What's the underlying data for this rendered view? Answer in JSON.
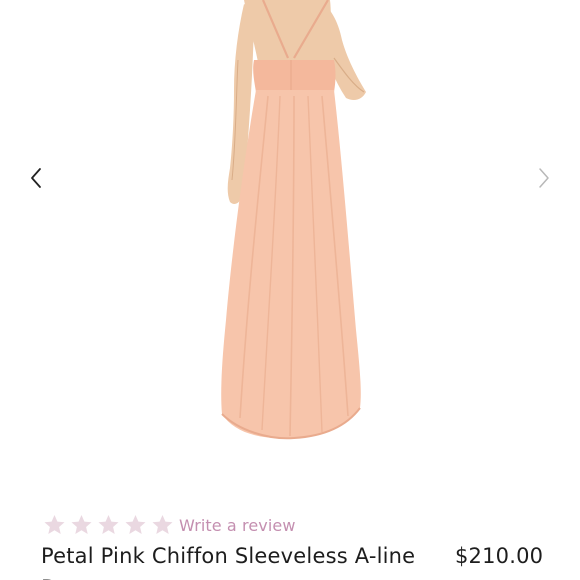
{
  "gallery": {
    "prev_icon": "chevron-left-icon",
    "next_icon": "chevron-right-icon",
    "photo_alt": "dress-photo",
    "colors": {
      "dress": "#f7c5ab",
      "dress_shadow": "#e9ab8e",
      "skin": "#eecaa9",
      "skin_shadow": "#d9ad88",
      "prev_arrow": "#222222",
      "next_arrow": "#b8b8b8"
    }
  },
  "reviews": {
    "star_count": 5,
    "rating": 0,
    "star_icon": "star-icon",
    "star_color": "#ead8e1",
    "link_text": "Write a review",
    "link_color": "#c48fb0"
  },
  "product": {
    "title": "Petal Pink Chiffon Sleeveless A-line Dress",
    "price": "$210.00"
  }
}
